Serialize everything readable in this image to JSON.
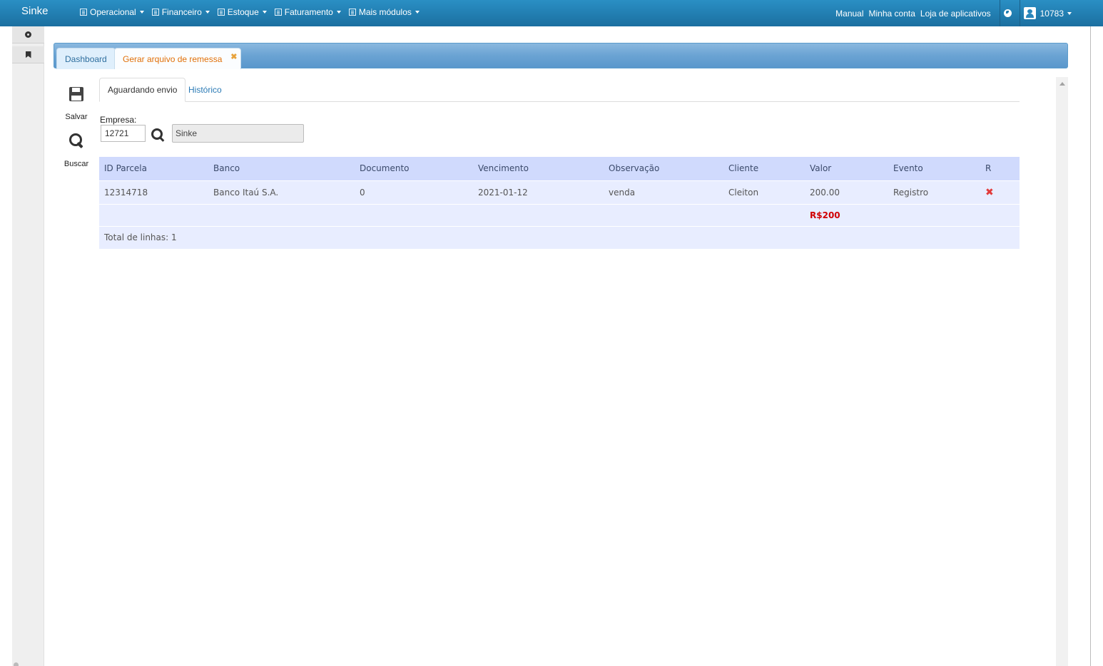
{
  "brand": "Sinke",
  "menu": [
    {
      "label": "Operacional"
    },
    {
      "label": "Financeiro"
    },
    {
      "label": "Estoque"
    },
    {
      "label": "Faturamento"
    },
    {
      "label": "Mais módulos"
    }
  ],
  "right_links": {
    "manual": "Manual",
    "account": "Minha conta",
    "store": "Loja de aplicativos",
    "user_id": "10783"
  },
  "tabs": {
    "dashboard": "Dashboard",
    "current": "Gerar arquivo de remessa",
    "close_glyph": "✖"
  },
  "tools": {
    "save": "Salvar",
    "search": "Buscar"
  },
  "inner_tabs": {
    "pending": "Aguardando envio",
    "history": "Histórico"
  },
  "empresa": {
    "label": "Empresa:",
    "code": "12721",
    "name": "Sinke"
  },
  "table": {
    "headers": [
      "ID Parcela",
      "Banco",
      "Documento",
      "Vencimento",
      "Observação",
      "Cliente",
      "Valor",
      "Evento",
      "R"
    ],
    "rows": [
      {
        "id": "12314718",
        "banco": "Banco Itaú S.A.",
        "documento": "0",
        "vencimento": "2021-01-12",
        "observacao": "venda",
        "cliente": "Cleiton",
        "valor": "200.00",
        "evento": "Registro",
        "remove": "✖"
      }
    ],
    "total": "R$200",
    "count": "Total de linhas: 1"
  },
  "colors": {
    "navbar": "#1f7bb0",
    "header_row": "#d0dafd",
    "row": "#e8edff",
    "total": "#d00000",
    "tab_active_text": "#e17009"
  }
}
